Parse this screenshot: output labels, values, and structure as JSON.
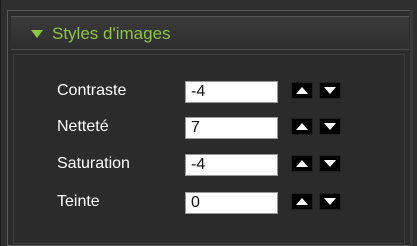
{
  "panel": {
    "title": "Styles d'images",
    "accent_color": "#8ec63f",
    "expanded_icon": "triangle-down-icon"
  },
  "settings": [
    {
      "label": "Contraste",
      "value": "-4"
    },
    {
      "label": "Netteté",
      "value": "7"
    },
    {
      "label": "Saturation",
      "value": "-4"
    },
    {
      "label": "Teinte",
      "value": "0"
    }
  ],
  "controls": {
    "increment_icon": "triangle-up-icon",
    "decrement_icon": "triangle-down-icon"
  }
}
